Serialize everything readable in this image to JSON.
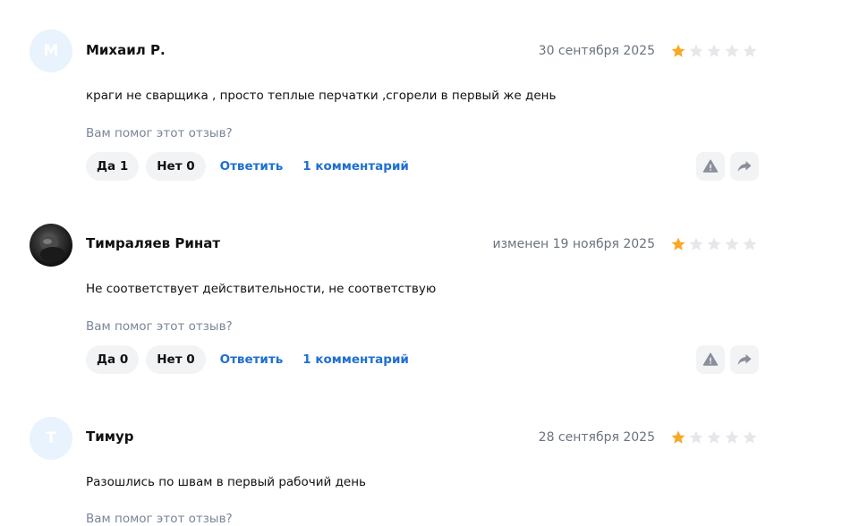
{
  "helpful_question": "Вам помог этот отзыв?",
  "colors": {
    "star_filled": "#f9a825",
    "star_empty": "#e6e7eb",
    "link": "#1f6fd1",
    "avatar_bg": "#e8f3fd"
  },
  "reviews": [
    {
      "avatar_letter": "М",
      "author": "Михаил Р.",
      "date": "30 сентября 2025",
      "rating": 1,
      "text": "краги не сварщика , просто теплые перчатки ,сгорели в первый же день",
      "yes_label": "Да 1",
      "no_label": "Нет 0",
      "reply_label": "Ответить",
      "comments_label": "1 комментарий"
    },
    {
      "avatar_letter": "",
      "author": "Тимраляев Ринат",
      "date": "изменен 19 ноября 2025",
      "rating": 1,
      "text": "Не соответствует действительности, не соответствую",
      "yes_label": "Да 0",
      "no_label": "Нет 0",
      "reply_label": "Ответить",
      "comments_label": "1 комментарий"
    },
    {
      "avatar_letter": "Т",
      "author": "Тимур",
      "date": "28 сентября 2025",
      "rating": 1,
      "text": "Разошлись по швам в первый рабочий день"
    }
  ]
}
